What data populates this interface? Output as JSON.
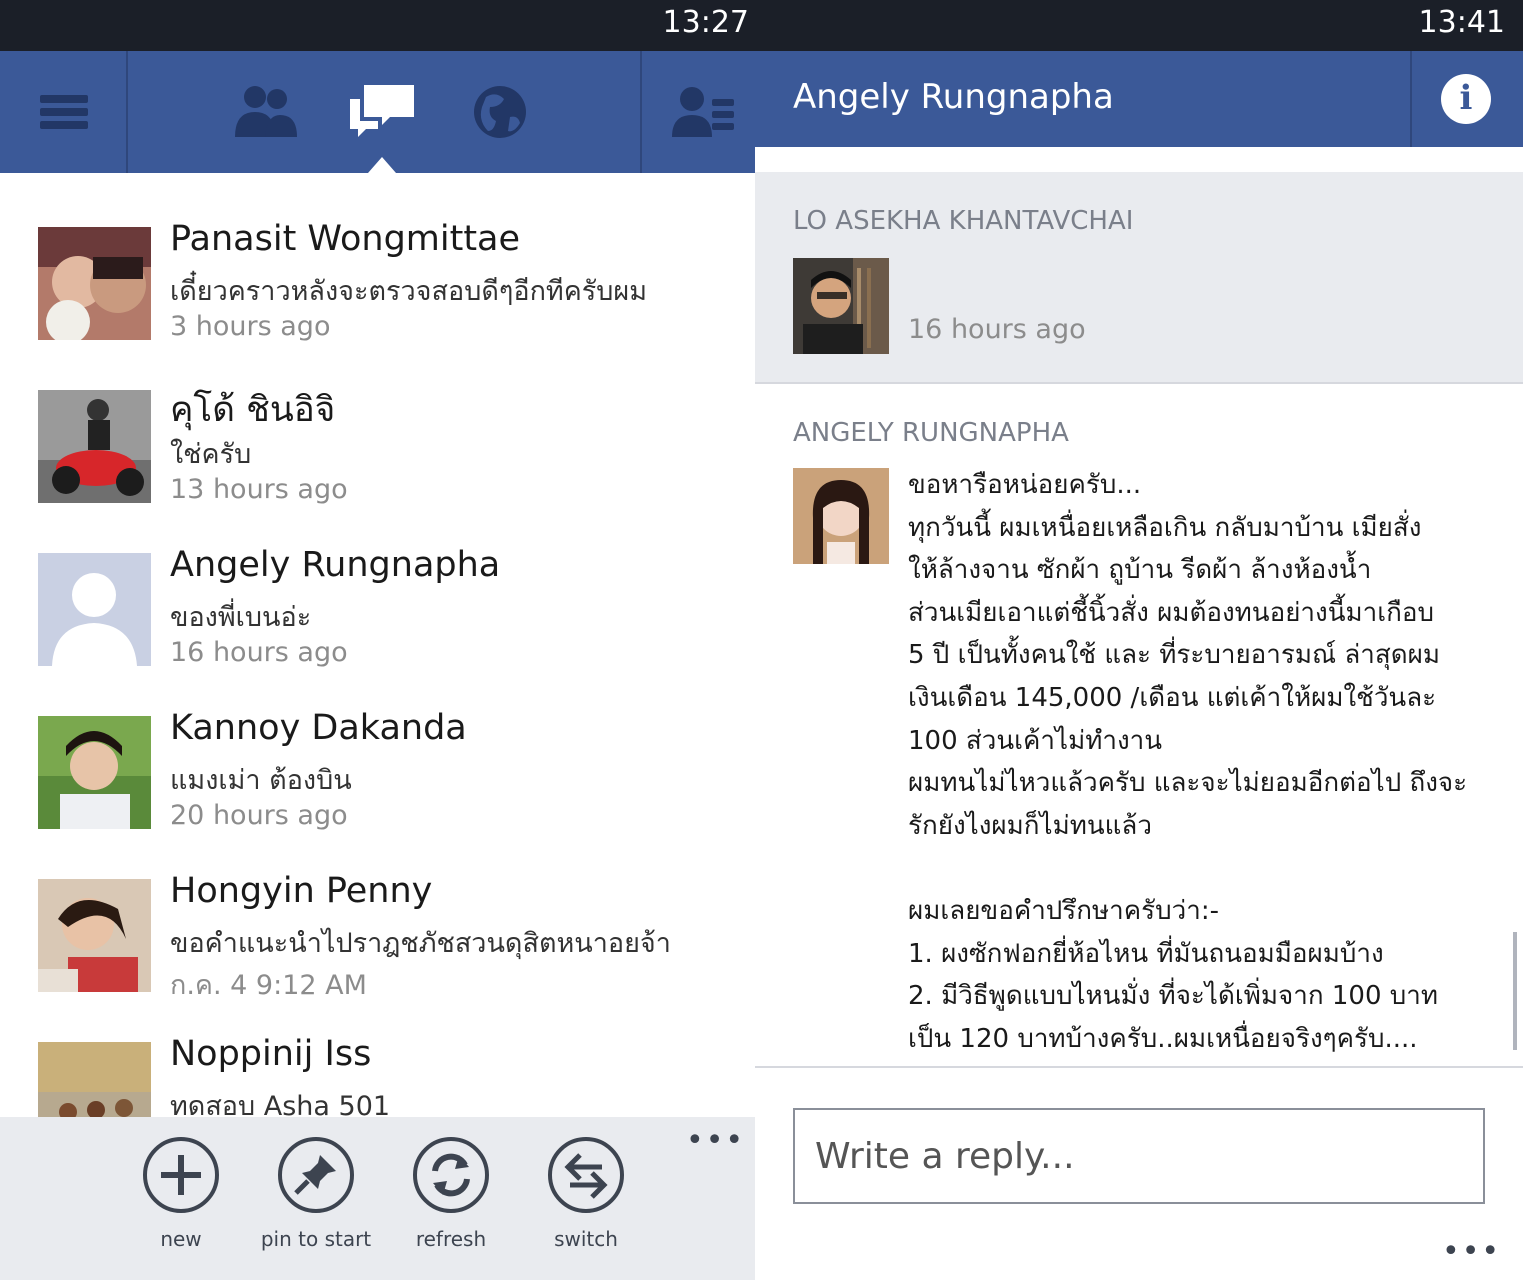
{
  "left": {
    "status": {
      "time": "13:27"
    },
    "conversations": [
      {
        "name": "Panasit Wongmittae",
        "snippet": "เดี๋ยวคราวหลังจะตรวจสอบดีๆอีกทีครับผม",
        "time": "3 hours ago"
      },
      {
        "name": "คุโด้ ชินอิจิ",
        "snippet": "ใช่ครับ",
        "time": "13 hours ago"
      },
      {
        "name": "Angely Rungnapha",
        "snippet": "ของพี่เบนอ่ะ",
        "time": "16 hours ago"
      },
      {
        "name": "Kannoy Dakanda",
        "snippet": "แมงเม่า ต้องบิน",
        "time": "20 hours ago"
      },
      {
        "name": "Hongyin Penny",
        "snippet": "ขอคำแนะนำไปราฎชภัชสวนดุสิตหนาอยจ้า",
        "time": "ก.ค. 4 9:12 AM"
      },
      {
        "name": "Noppinij Iss",
        "snippet": "ทดสอบ Asha 501",
        "time": ""
      }
    ],
    "appbar": {
      "new": "new",
      "pin": "pin to start",
      "refresh": "refresh",
      "switch": "switch",
      "more": "•••"
    }
  },
  "right": {
    "status": {
      "time": "13:41"
    },
    "header": {
      "title": "Angely Rungnapha",
      "info": "i"
    },
    "messages": [
      {
        "sender": "LO ASEKHA KHANTAVCHAI",
        "time": "16 hours ago",
        "body": ""
      },
      {
        "sender": "ANGELY RUNGNAPHA",
        "time": "",
        "body": "ขอหารือหน่อยครับ...\nทุกวันนี้ ผมเหนื่อยเหลือเกิน กลับมาบ้าน เมียสั่ง\nให้ล้างจาน ซักผ้า ถูบ้าน รีดผ้า ล้างห้องน้ำ\nส่วนเมียเอาแต่ชี้นิ้วสั่ง ผมต้องทนอย่างนี้มาเกือบ\n5 ปี เป็นทั้งคนใช้ และ ที่ระบายอารมณ์ ล่าสุดผม\nเงินเดือน 145,000 /เดือน แต่เค้าให้ผมใช้วันละ\n100 ส่วนเค้าไม่ทำงาน\nผมทนไม่ไหวแล้วครับ และจะไม่ยอมอีกต่อไป ถึงจะ\nรักยังไงผมก็ไม่ทนแล้ว\n\nผมเลยขอคำปรึกษาครับว่า:-\n1. ผงซักฟอกยี่ห้อไหน ที่มันถนอมมือผมบ้าง\n2. มีวิธีพูดแบบไหนมั่ง ที่จะได้เพิ่มจาก 100 บาท\nเป็น 120 บาทบ้างครับ..ผมเหนื่อยจริงๆครับ...."
      }
    ],
    "reply": {
      "placeholder": "Write a reply..."
    },
    "more": "•••"
  }
}
